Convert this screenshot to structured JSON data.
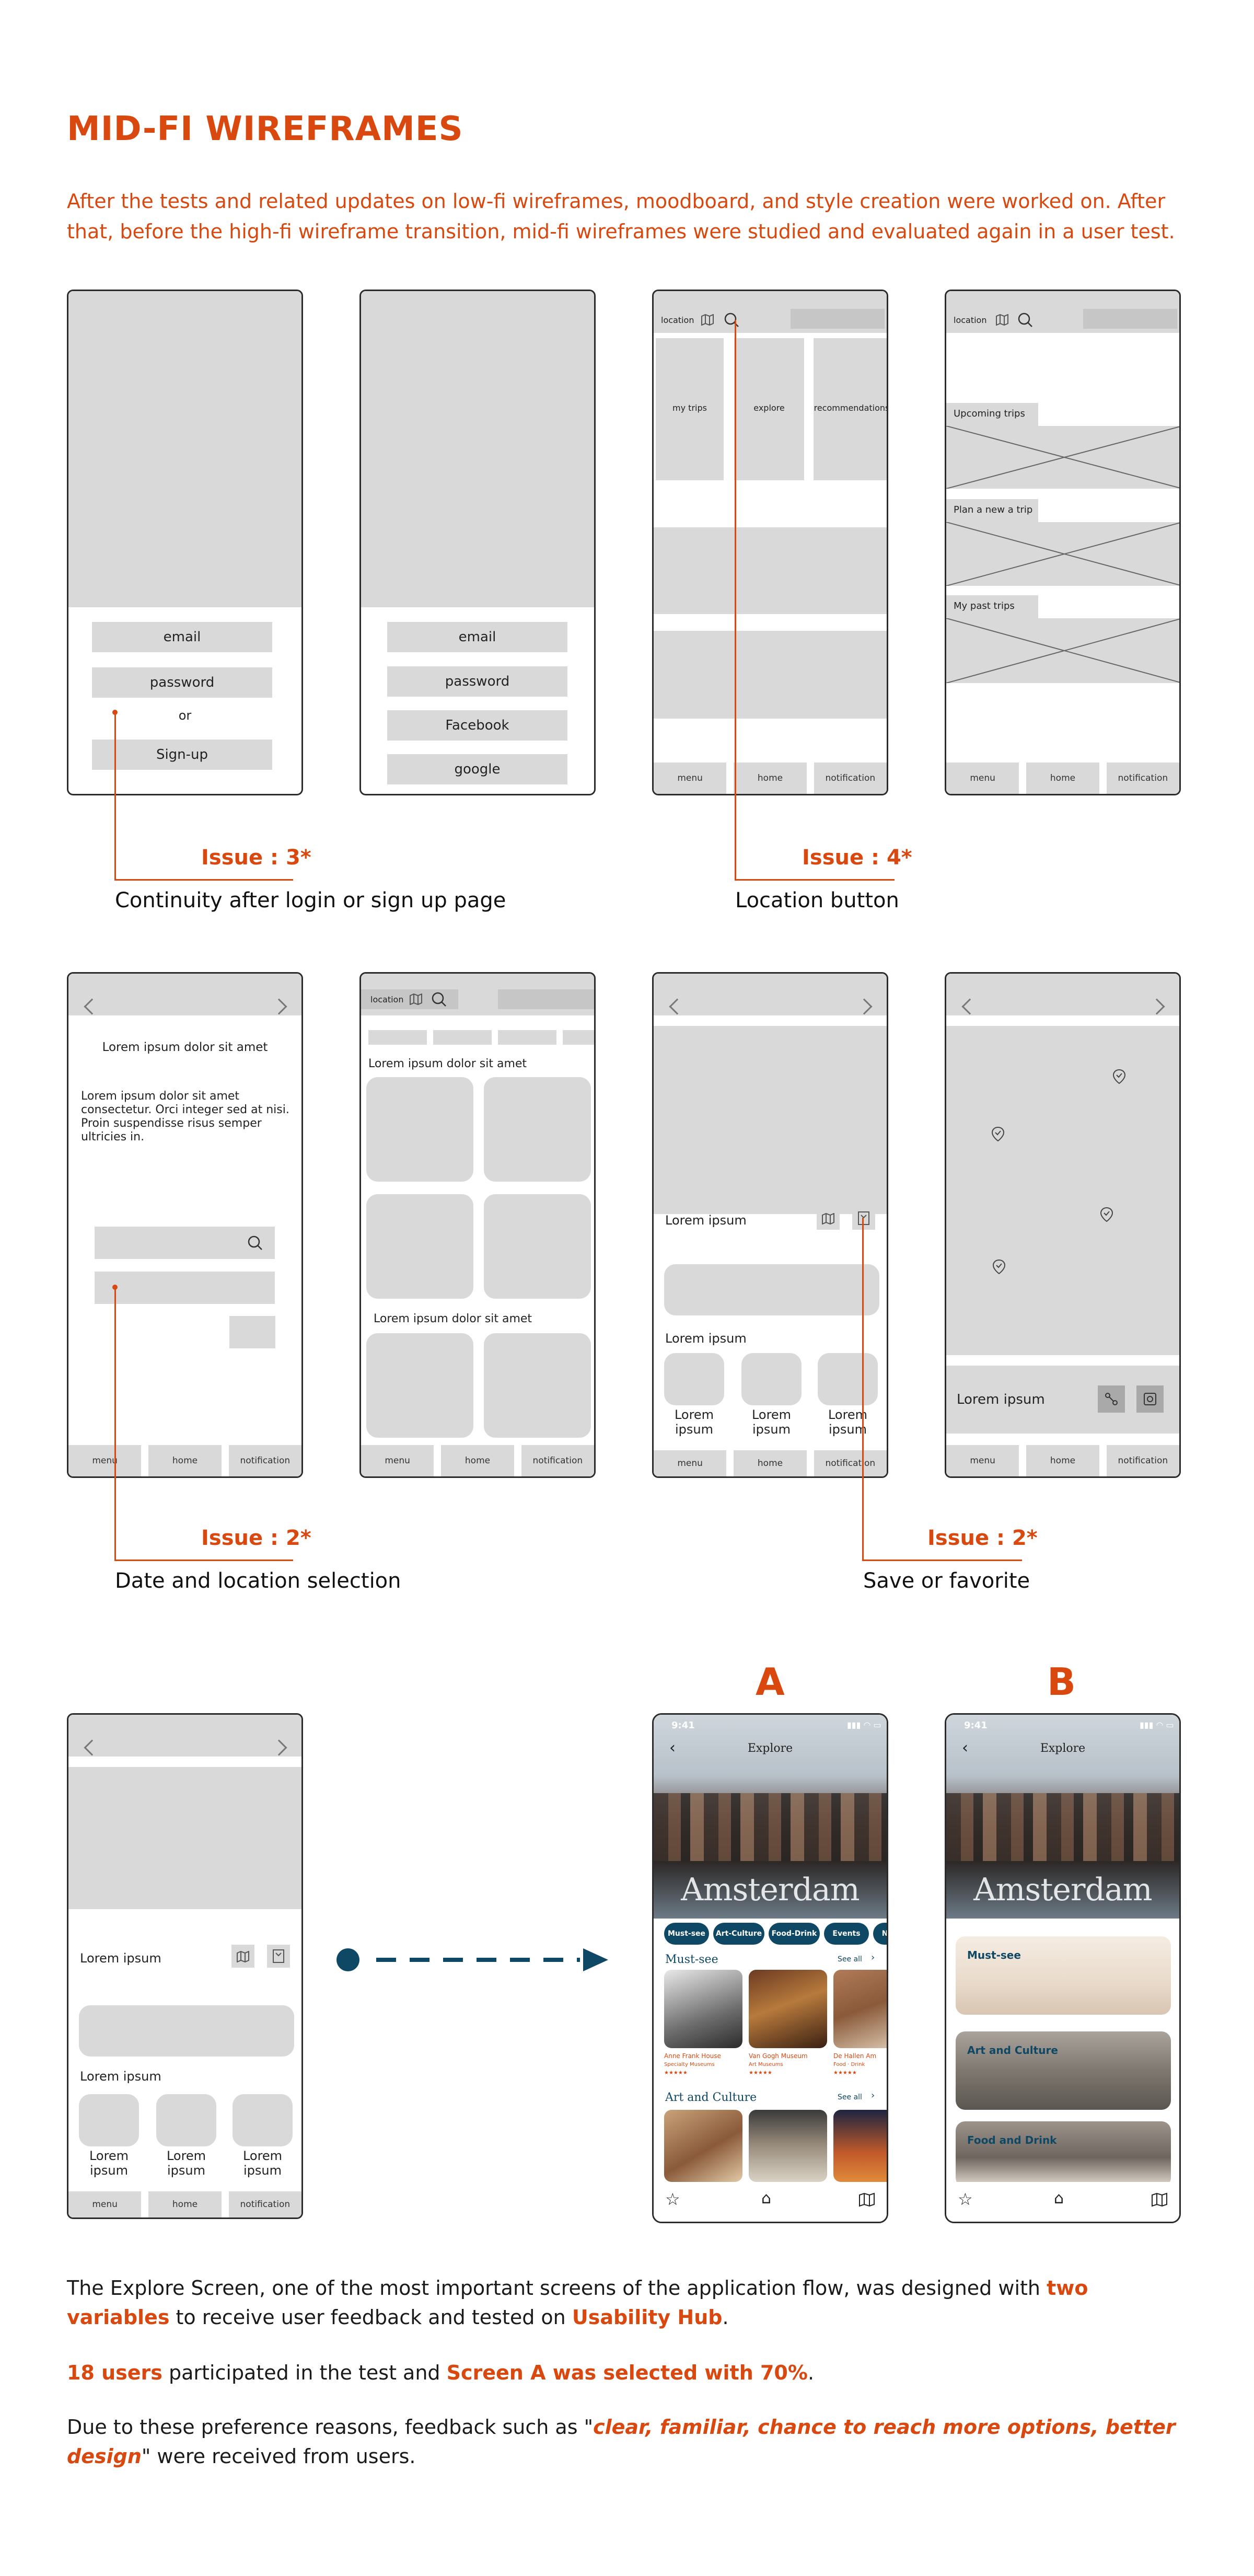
{
  "header": {
    "title": "MID-FI WIREFRAMES",
    "intro": "After the tests and related updates on low-fi wireframes, moodboard, and style creation were worked on. After that, before the high-fi wireframe transition, mid-fi wireframes were studied and evaluated again in a user test."
  },
  "wireframes": {
    "login": {
      "email": "email",
      "password": "password",
      "or": "or",
      "signup": "Sign-up"
    },
    "signup": {
      "email": "email",
      "password": "password",
      "facebook": "Facebook",
      "google": "google"
    },
    "home": {
      "location": "location",
      "tiles": [
        "my trips",
        "explore",
        "recommendations"
      ]
    },
    "trips": {
      "location": "location",
      "sections": [
        "Upcoming trips",
        "Plan a new a trip",
        "My past trips"
      ]
    },
    "nav": {
      "menu": "menu",
      "home": "home",
      "notification": "notification"
    },
    "date_select": {
      "heading": "Lorem ipsum dolor sit amet",
      "body": "Lorem ipsum dolor sit amet consectetur. Orci integer sed at nisi. Proin suspendisse risus semper ultricies in."
    },
    "explore_grid": {
      "location": "location",
      "heading1": "Lorem ipsum dolor sit amet",
      "heading2": "Lorem ipsum dolor sit amet"
    },
    "detail": {
      "title": "Lorem ipsum",
      "section": "Lorem ipsum",
      "items": [
        "Lorem ipsum",
        "Lorem ipsum",
        "Lorem ipsum"
      ]
    },
    "map": {
      "title": "Lorem ipsum"
    }
  },
  "annotations": {
    "issue3": {
      "label": "Issue : 3*",
      "caption": "Continuity after login or sign up page"
    },
    "issue4": {
      "label": "Issue : 4*",
      "caption": "Location button"
    },
    "issue2a": {
      "label": "Issue : 2*",
      "caption": "Date and location selection"
    },
    "issue2b": {
      "label": "Issue : 2*",
      "caption": "Save or favorite"
    }
  },
  "variants": {
    "a_label": "A",
    "b_label": "B",
    "time": "9:41",
    "screen_title": "Explore",
    "hero_word": "Amsterdam",
    "chips": [
      "Must-see",
      "Art-Culture",
      "Food-Drink",
      "Events",
      "Ni"
    ],
    "must_see": "Must-see",
    "see_all": "See all",
    "art_culture": "Art and Culture",
    "cards": [
      {
        "name": "Anne Frank House",
        "sub": "Specialty Museums"
      },
      {
        "name": "Van Gogh Museum",
        "sub": "Art Museums"
      },
      {
        "name": "De Hallen Am",
        "sub": "Food · Drink"
      }
    ],
    "b_cards": [
      "Must-see",
      "Art and Culture",
      "Food and Drink"
    ]
  },
  "footer": {
    "p1_a": "The Explore Screen, one of the most important screens of the application flow, was designed with ",
    "p1_b": "two variables",
    "p1_c": " to receive user feedback and tested on ",
    "p1_d": "Usability Hub",
    "p1_e": ".",
    "p2_a": "18 users",
    "p2_b": " participated in the test and ",
    "p2_c": "Screen A was selected with 70%",
    "p2_d": ".",
    "p3_a": "Due to these preference reasons, feedback such as \"",
    "p3_b": "clear, familiar, chance to reach more options, better design",
    "p3_c": "\" were received from users."
  },
  "colors": {
    "accent": "#d9480f",
    "navy": "#0f4864",
    "wire": "#d9d9d9"
  }
}
